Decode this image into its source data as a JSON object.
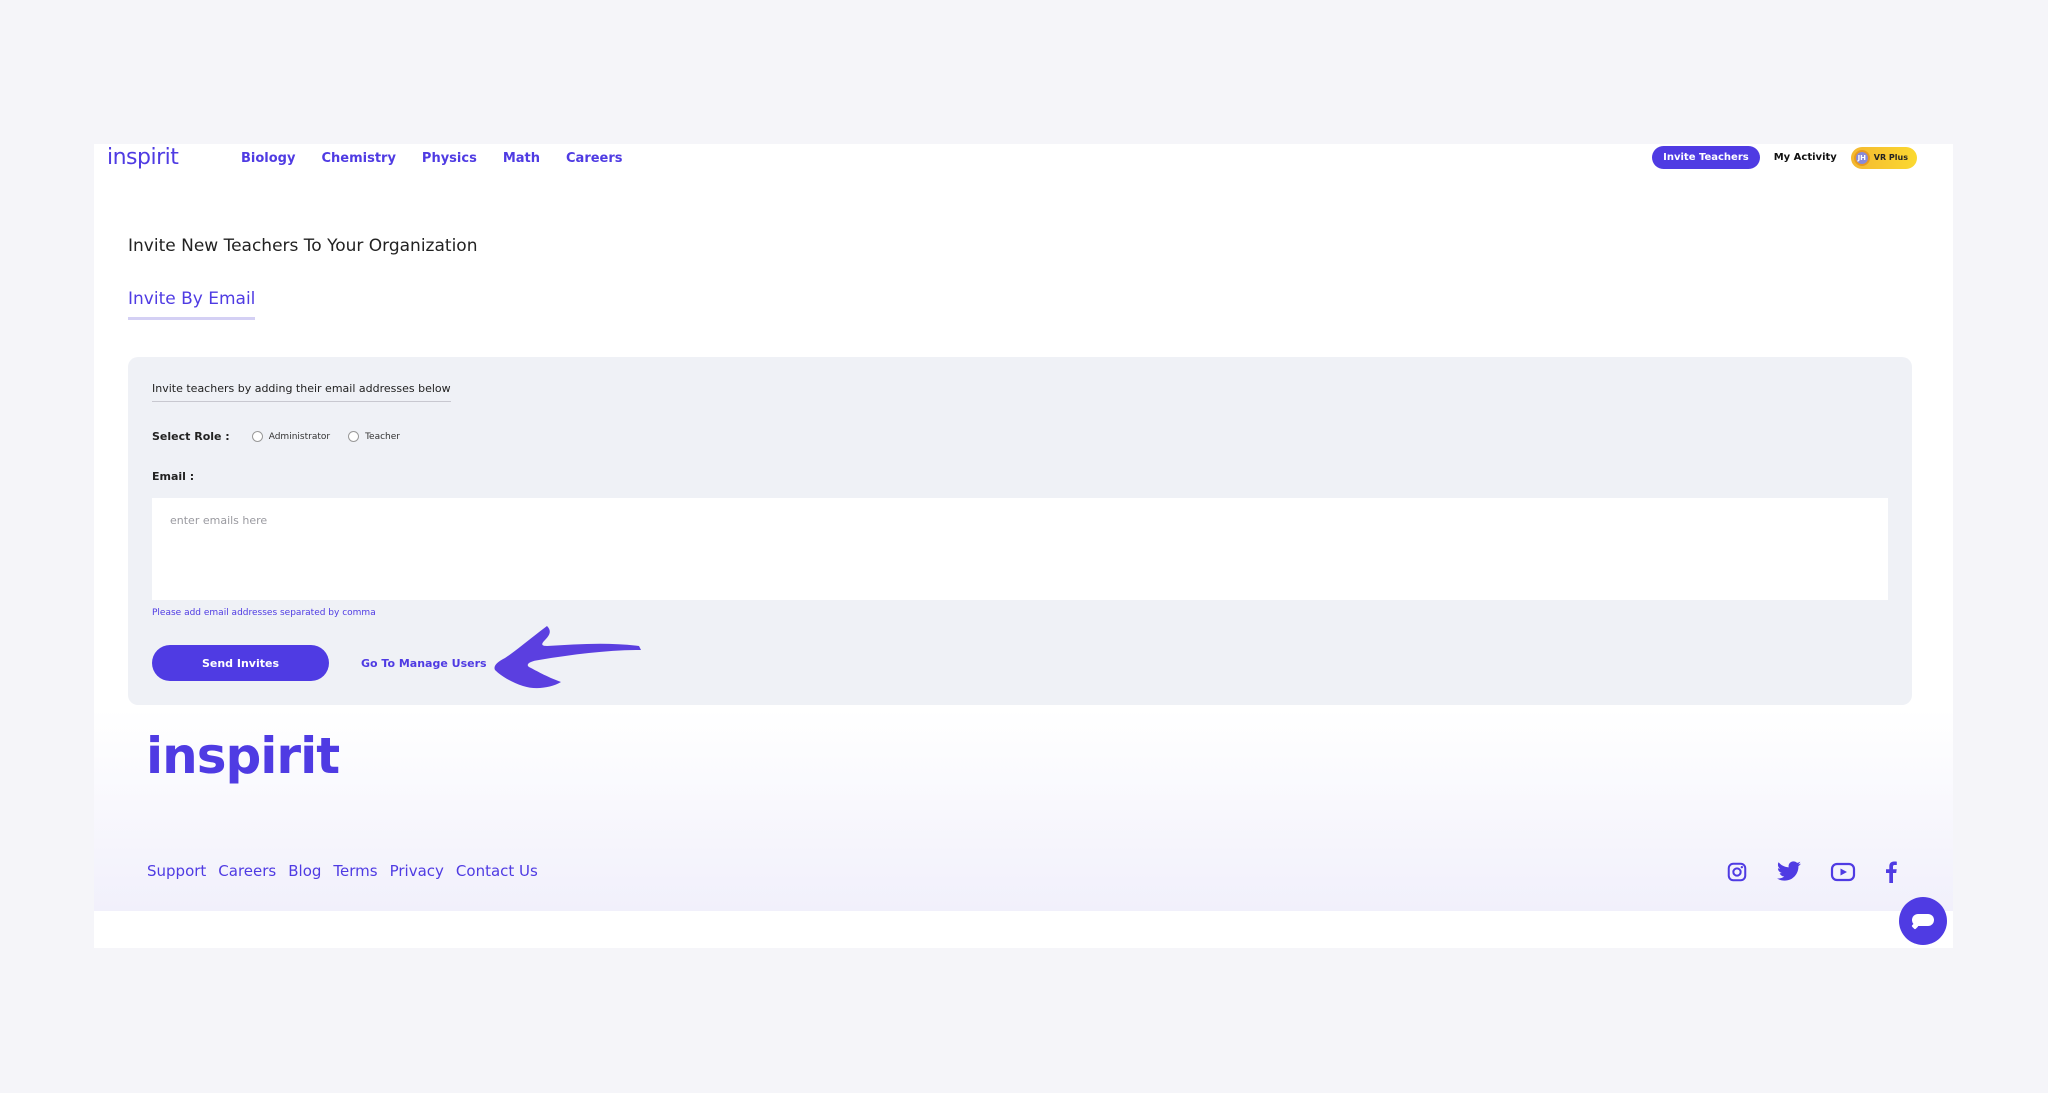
{
  "header": {
    "logo": "inspirit",
    "nav": [
      "Biology",
      "Chemistry",
      "Physics",
      "Math",
      "Careers"
    ],
    "invite_button": "Invite Teachers",
    "activity_link": "My Activity",
    "avatar_initials": "JH",
    "plan_badge": "VR Plus"
  },
  "main": {
    "title": "Invite New Teachers To Your Organization",
    "tab": "Invite By Email",
    "intro": "Invite teachers by adding their email addresses below",
    "role_label": "Select Role :",
    "roles": [
      "Administrator",
      "Teacher"
    ],
    "email_label": "Email :",
    "email_placeholder": "enter emails here",
    "email_value": "",
    "hint": "Please add email addresses separated by comma",
    "send_button": "Send Invites",
    "manage_link": "Go To Manage Users"
  },
  "footer": {
    "logo": "inspirit",
    "links": [
      "Support",
      "Careers",
      "Blog",
      "Terms",
      "Privacy",
      "Contact Us"
    ],
    "social_icons": [
      "instagram-icon",
      "twitter-icon",
      "youtube-icon",
      "facebook-icon"
    ]
  },
  "colors": {
    "brand": "#4f3be3",
    "badge": "#fbd930",
    "card_bg": "#eff1f6"
  }
}
